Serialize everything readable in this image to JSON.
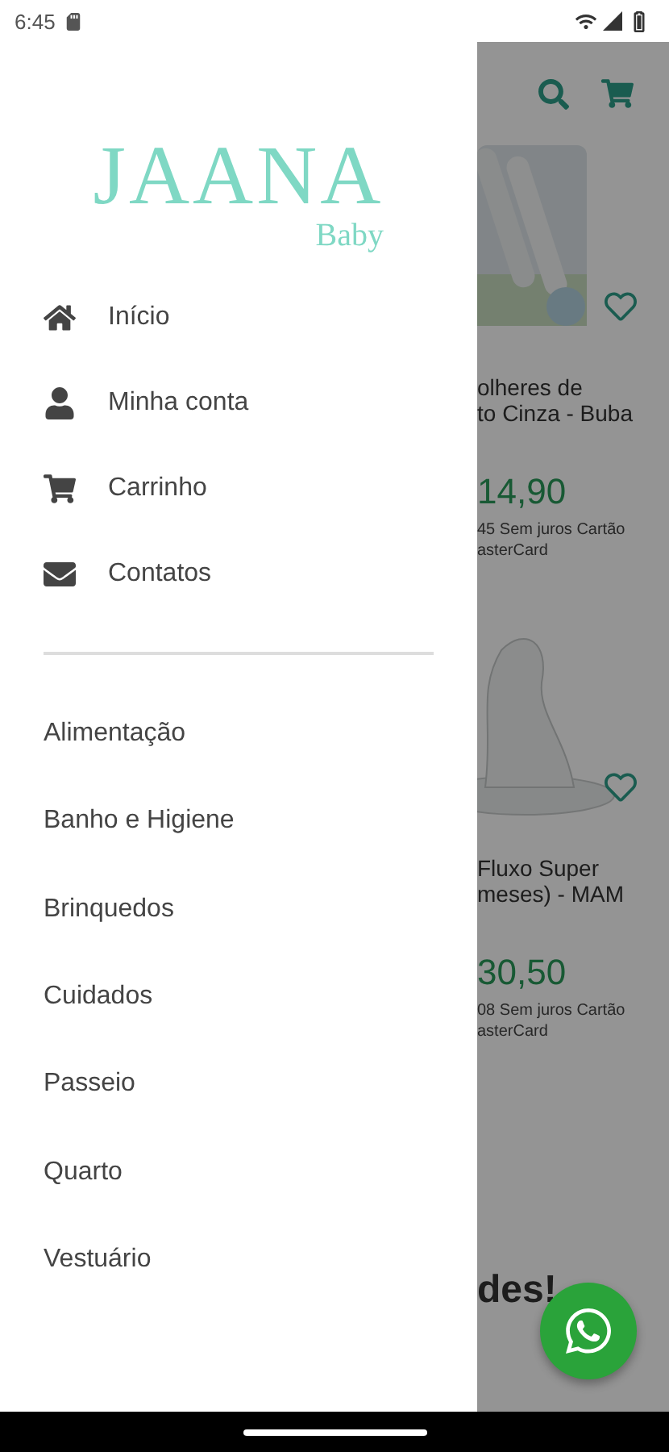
{
  "status_bar": {
    "time": "6:45"
  },
  "drawer": {
    "logo": {
      "title": "JAANA",
      "subtitle": "Baby"
    },
    "menu": [
      {
        "kind": "home",
        "label": "Início"
      },
      {
        "kind": "account",
        "label": "Minha conta"
      },
      {
        "kind": "cart",
        "label": "Carrinho"
      },
      {
        "kind": "mail",
        "label": "Contatos"
      }
    ],
    "categories": [
      "Alimentação",
      "Banho e Higiene",
      "Brinquedos",
      "Cuidados",
      "Passeio",
      "Quarto",
      "Vestuário"
    ]
  },
  "background_page": {
    "products": [
      {
        "name_lines": [
          "olheres de",
          "to Cinza - Buba"
        ],
        "price": "14,90",
        "installment_lines": [
          "45 Sem juros Cartão",
          "asterCard"
        ],
        "kind": "spoon"
      },
      {
        "name_lines": [
          "Fluxo Super",
          "meses) - MAM"
        ],
        "price": "30,50",
        "installment_lines": [
          "08 Sem juros Cartão",
          "asterCard"
        ],
        "kind": "nipple"
      }
    ],
    "section_title": "des!"
  }
}
